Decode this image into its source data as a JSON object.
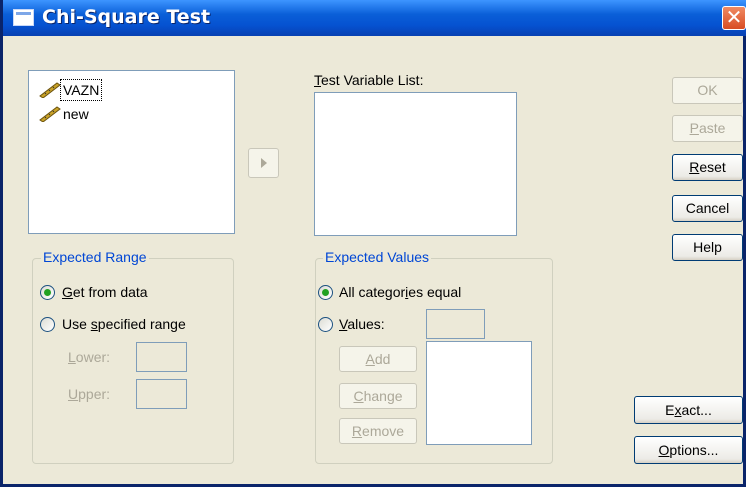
{
  "window": {
    "title": "Chi-Square Test",
    "close_glyph": "✕"
  },
  "variables": [
    {
      "name": "VAZN",
      "icon": "ruler-icon",
      "focused": true
    },
    {
      "name": "new",
      "icon": "ruler-icon",
      "focused": false
    }
  ],
  "move_button": {
    "icon": "right-arrow-icon"
  },
  "test_variable_list": {
    "label_u": "T",
    "label_rest": "est Variable List:"
  },
  "buttons": {
    "ok": "OK",
    "paste_u": "P",
    "paste_rest": "aste",
    "reset_u": "R",
    "reset_rest": "eset",
    "cancel": "Cancel",
    "help": "Help",
    "exact_pre": "E",
    "exact_u": "x",
    "exact_rest": "act...",
    "options_u": "O",
    "options_rest": "ptions..."
  },
  "expected_range": {
    "title": "Expected Range",
    "get_from_data_u": "G",
    "get_from_data_rest": "et from data",
    "use_specified_pre": "Use ",
    "use_specified_u": "s",
    "use_specified_rest": "pecified range",
    "lower_u": "L",
    "lower_rest": "ower:",
    "upper_u": "U",
    "upper_rest": "pper:",
    "selected": "get_from_data"
  },
  "expected_values": {
    "title": "Expected Values",
    "all_equal_pre": "All categor",
    "all_equal_u": "i",
    "all_equal_rest": "es equal",
    "values_u": "V",
    "values_rest": "alues:",
    "add_u": "A",
    "add_rest": "dd",
    "change_u": "C",
    "change_rest": "hange",
    "remove_u": "R",
    "remove_rest": "emove",
    "selected": "all_categories_equal"
  },
  "colors": {
    "title_bar": "#0a5fd8",
    "group_title": "#0046d5",
    "dialog_bg": "#ece9d8",
    "disabled_text": "#aca899"
  }
}
